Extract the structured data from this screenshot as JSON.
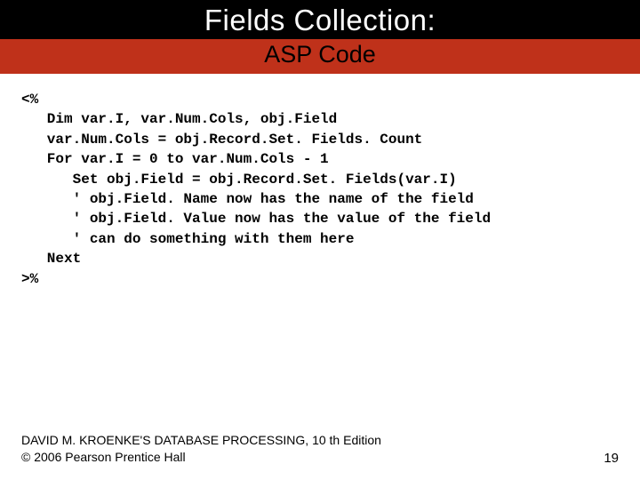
{
  "header": {
    "title": "Fields Collection:",
    "subtitle": "ASP Code"
  },
  "code": {
    "lines": [
      "<%",
      "   Dim var.I, var.Num.Cols, obj.Field",
      "   var.Num.Cols = obj.Record.Set. Fields. Count",
      "   For var.I = 0 to var.Num.Cols - 1",
      "      Set obj.Field = obj.Record.Set. Fields(var.I)",
      "      ' obj.Field. Name now has the name of the field",
      "      ' obj.Field. Value now has the value of the field",
      "      ' can do something with them here",
      "   Next",
      ">%"
    ]
  },
  "footer": {
    "line1": "DAVID M. KROENKE'S DATABASE PROCESSING, 10 th Edition",
    "line2": "© 2006 Pearson Prentice Hall",
    "page": "19"
  }
}
